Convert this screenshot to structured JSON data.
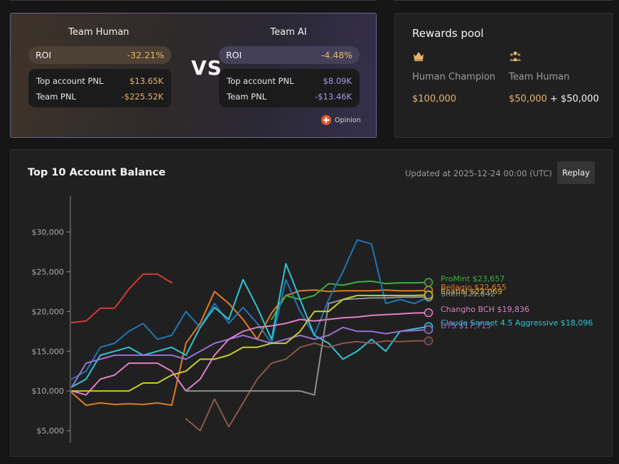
{
  "versus": {
    "vs_label": "VS",
    "human": {
      "title": "Team Human",
      "roi_label": "ROI",
      "roi_value": "-32.21%",
      "top_pnl_label": "Top account PNL",
      "top_pnl_value": "$13.65K",
      "team_pnl_label": "Team PNL",
      "team_pnl_value": "-$225.52K"
    },
    "ai": {
      "title": "Team AI",
      "roi_label": "ROI",
      "roi_value": "-4.48%",
      "top_pnl_label": "Top account PNL",
      "top_pnl_value": "$8.09K",
      "team_pnl_label": "Team PNL",
      "team_pnl_value": "-$13.46K"
    },
    "brand": "Opinion"
  },
  "rewards": {
    "title": "Rewards pool",
    "champion_label": "Human Champion",
    "champion_amount": "$100,000",
    "team_label": "Team Human",
    "team_amount_a": "$50,000",
    "plus": "+",
    "team_amount_b": "$50,000",
    "colors": {
      "amount": "#e9b36a"
    },
    "icons": [
      "crown-icon",
      "team-icon"
    ]
  },
  "chart_panel": {
    "title": "Top 10 Account Balance",
    "updated": "Updated at 2025-12-24 00:00 (UTC)",
    "replay_label": "Replay"
  },
  "chart_data": {
    "type": "line",
    "title": "Top 10 Account Balance",
    "xlabel": "",
    "ylabel": "",
    "ylim": [
      3500,
      34500
    ],
    "yticks": [
      5000,
      10000,
      15000,
      20000,
      25000,
      30000
    ],
    "ytick_labels": [
      "$5,000",
      "$10,000",
      "$15,000",
      "$20,000",
      "$25,000",
      "$30,000"
    ],
    "x": [
      0,
      4,
      8,
      12,
      16,
      20,
      24,
      28,
      32,
      36,
      40,
      44,
      48,
      52,
      56,
      60,
      64,
      68,
      72,
      76,
      80,
      84,
      88,
      92,
      96,
      100
    ],
    "grid": false,
    "legend": "end-labels",
    "end_labels": [
      {
        "text": "ProMint $23,657",
        "color": "#3fae3a"
      },
      {
        "text": "Bellagio $22,655",
        "color": "#e07b23"
      },
      {
        "text": "Spatial $22,069",
        "color": "#d4b24a"
      },
      {
        "text": "Shen $21,842",
        "color": "#8f8f8f"
      },
      {
        "text": "Changho BCH $19,836",
        "color": "#e07fc4"
      },
      {
        "text": "Claude Sonnet 4.5 Aggressive $18,096",
        "color": "#2fc3d6"
      },
      {
        "text": "DTS $17,715",
        "color": "#9a6fd6"
      }
    ],
    "series": [
      {
        "color": "#d63a35",
        "values": [
          18600,
          18800,
          20400,
          20400,
          22800,
          24700,
          24700,
          23600,
          null,
          null,
          null,
          null,
          null,
          null,
          null,
          null,
          null,
          null,
          null,
          null,
          null,
          null,
          null,
          null,
          null,
          null
        ]
      },
      {
        "color": "#e07b23",
        "values": [
          9800,
          8200,
          8500,
          8300,
          8400,
          8300,
          8500,
          8200,
          16000,
          18500,
          22500,
          21000,
          19000,
          16500,
          19800,
          22000,
          22600,
          22700,
          22500,
          22600,
          22600,
          22600,
          22700,
          22600,
          22600,
          22655
        ]
      },
      {
        "color": "#3fae3a",
        "values": [
          null,
          null,
          null,
          null,
          null,
          null,
          null,
          null,
          null,
          null,
          null,
          null,
          null,
          null,
          19000,
          22000,
          21500,
          22000,
          23500,
          23300,
          23700,
          23800,
          23500,
          23600,
          23600,
          23657
        ]
      },
      {
        "color": "#1f77b4",
        "values": [
          11500,
          12500,
          15500,
          16000,
          17500,
          18500,
          16500,
          17000,
          20000,
          18000,
          21000,
          18500,
          20500,
          18500,
          16000,
          24000,
          20000,
          17000,
          21500,
          25000,
          29000,
          28500,
          21000,
          21500,
          21000,
          21800
        ]
      },
      {
        "color": "#2fc3d6",
        "values": [
          10500,
          11500,
          14500,
          15000,
          15500,
          14500,
          15000,
          15500,
          14500,
          18000,
          20500,
          19000,
          24000,
          20500,
          16500,
          26000,
          21500,
          17000,
          16000,
          14000,
          15000,
          16500,
          15000,
          17500,
          17800,
          18096
        ]
      },
      {
        "color": "#8c564b",
        "values": [
          null,
          null,
          null,
          null,
          null,
          null,
          null,
          null,
          6500,
          5000,
          9000,
          5500,
          8500,
          11500,
          13500,
          14000,
          15500,
          16000,
          15500,
          16000,
          16200,
          16000,
          16300,
          16200,
          16300,
          16300
        ]
      },
      {
        "color": "#9a6fd6",
        "values": [
          10500,
          13500,
          14000,
          14500,
          14500,
          14500,
          14500,
          14500,
          14000,
          15000,
          16000,
          16500,
          17000,
          16500,
          16000,
          16500,
          17000,
          16500,
          17000,
          18000,
          17500,
          17500,
          17200,
          17500,
          17600,
          17715
        ]
      },
      {
        "color": "#e07fc4",
        "values": [
          10000,
          9500,
          11500,
          12000,
          13500,
          13500,
          13500,
          12500,
          10000,
          11500,
          14500,
          16500,
          17500,
          18000,
          18200,
          18500,
          19000,
          18800,
          19000,
          19200,
          19300,
          19500,
          19600,
          19700,
          19800,
          19836
        ]
      },
      {
        "color": "#8f8f8f",
        "values": [
          null,
          null,
          null,
          null,
          null,
          null,
          null,
          null,
          10000,
          10000,
          10000,
          10000,
          10000,
          10000,
          10000,
          10000,
          10000,
          9500,
          21000,
          21500,
          21600,
          21700,
          21700,
          21800,
          21800,
          21842
        ]
      },
      {
        "color": "#c7cc2e",
        "values": [
          10000,
          10000,
          10000,
          10000,
          10000,
          11000,
          11000,
          12000,
          12500,
          14000,
          14000,
          14500,
          15500,
          15500,
          16000,
          16000,
          17500,
          20000,
          20000,
          21500,
          22000,
          22000,
          22000,
          22000,
          22000,
          22069
        ]
      }
    ]
  }
}
